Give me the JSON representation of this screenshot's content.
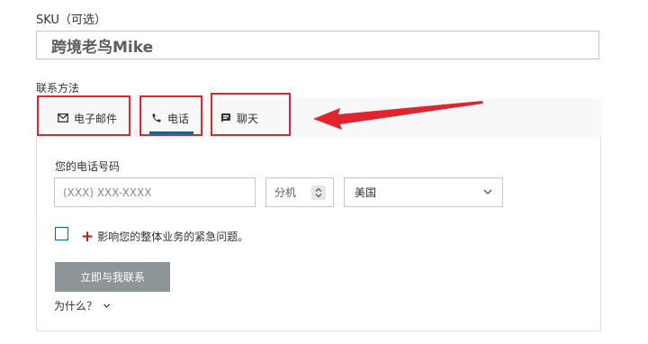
{
  "sku": {
    "label": "SKU（可选）",
    "value": "跨境老鸟Mike"
  },
  "contact": {
    "label": "联系方法",
    "tabs": [
      {
        "label": "电子邮件",
        "icon": "mail-icon"
      },
      {
        "label": "电话",
        "icon": "phone-icon",
        "selected": true
      },
      {
        "label": "聊天",
        "icon": "chat-icon"
      }
    ]
  },
  "phone_form": {
    "label": "您的电话号码",
    "phone_placeholder": "(XXX) XXX-XXXX",
    "ext_placeholder": "分机",
    "country": "美国",
    "urgent_label": "影响您的整体业务的紧急问题。",
    "submit_label": "立即与我联系",
    "why_label": "为什么？"
  },
  "colors": {
    "accent": "#0d6a8c",
    "highlight": "#e0252f",
    "button": "#8e9598",
    "required": "#c50f1f"
  }
}
